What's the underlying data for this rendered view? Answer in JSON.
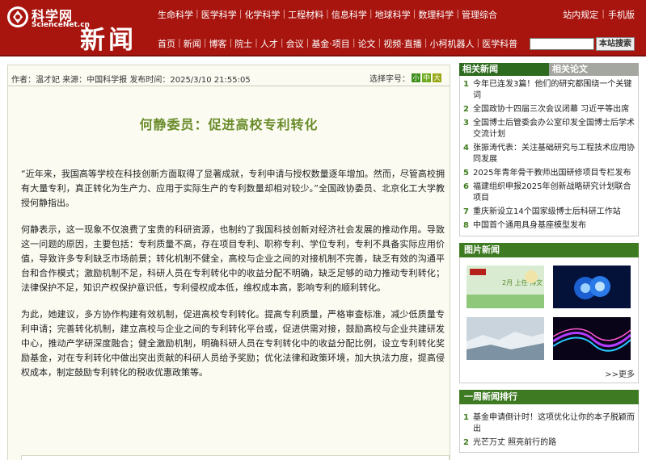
{
  "header": {
    "logo_cn": "科学网",
    "logo_en": "ScienceNet.cn",
    "channel_title": "新闻",
    "subject_nav": [
      "生命科学",
      "医学科学",
      "化学科学",
      "工程材料",
      "信息科学",
      "地球科学",
      "数理科学",
      "管理综合"
    ],
    "main_nav": [
      "首页",
      "新闻",
      "博客",
      "院士",
      "人才",
      "会议",
      "基金·项目",
      "论文",
      "视频·直播",
      "小柯机器人",
      "医学科普"
    ],
    "top_links": [
      "站内规定",
      "手机版"
    ],
    "search_placeholder": "",
    "search_button": "本站搜索"
  },
  "article": {
    "meta": "作者：温才妃 来源：中国科学报 发布时间：2025/3/10 21:55:05",
    "font_size_label": "选择字号：",
    "font_sizes": [
      "小",
      "中",
      "大"
    ],
    "title": "何静委员：促进高校专利转化",
    "paragraphs": [
      "“近年来，我国高等学校在科技创新方面取得了显著成就，专利申请与授权数量逐年增加。然而，尽管高校拥有大量专利，真正转化为生产力、应用于实际生产的专利数量却相对较少。”全国政协委员、北京化工大学教授何静指出。",
      "何静表示，这一现象不仅浪费了宝贵的科研资源，也制约了我国科技创新对经济社会发展的推动作用。导致这一问题的原因，主要包括：专利质量不高，存在项目专利、职称专利、学位专利，专利不具备实际应用价值，导致许多专利缺乏市场前景；转化机制不健全，高校与企业之间的对接机制不完善，缺乏有效的沟通平台和合作模式；激励机制不足，科研人员在专利转化中的收益分配不明确，缺乏足够的动力推动专利转化；法律保护不足，知识产权保护意识低，专利侵权成本低，维权成本高，影响专利的顺利转化。",
      "为此，她建议，多方协作构建有效机制，促进高校专利转化。提高专利质量，严格审查标准，减少低质量专利申请；完善转化机制，建立高校与企业之间的专利转化平台或，促进供需对接，鼓励高校与企业共建研发中心，推动产学研深度融合；健全激励机制，明确科研人员在专利转化中的收益分配比例，设立专利转化奖励基金，对在专利转化中做出突出贡献的科研人员给予奖励；优化法律和政策环境，加大执法力度，提高侵权成本，制定鼓励专利转化的税收优惠政策等。"
    ]
  },
  "sidebar": {
    "tabs": [
      "相关新闻",
      "相关论文"
    ],
    "related_news": [
      {
        "num": "1",
        "text": "今年已连发3篇！他们的研究都围绕一个关键词"
      },
      {
        "num": "2",
        "text": "全国政协十四届三次会议闭幕 习近平等出席"
      },
      {
        "num": "3",
        "text": "全国博士后管委会办公室印发全国博士后学术交流计划"
      },
      {
        "num": "4",
        "text": "张振涛代表：关注基础研究与工程技术应用协同发展"
      },
      {
        "num": "5",
        "text": "2025年青年骨干教师出国研修项目专栏发布"
      },
      {
        "num": "6",
        "text": "福建组织申报2025年创新战略研究计划联合项目"
      },
      {
        "num": "7",
        "text": "重庆新设立14个国家级博士后科研工作站"
      },
      {
        "num": "8",
        "text": "中国首个通用具身基座模型发布"
      }
    ],
    "photo_title": "图片新闻",
    "photo_overlay_text": "2月 上任·博文",
    "more": ">>更多",
    "weekly_title": "一周新闻排行",
    "weekly_news": [
      {
        "num": "1",
        "text": "基金申请倒计时！这项优化让你的本子脱颖而出"
      },
      {
        "num": "2",
        "text": "光芒万丈 照亮前行的路"
      }
    ]
  },
  "colors": {
    "header_red": "#a8150f",
    "title_green": "#6a8c2a",
    "section_green": "#3e7a22"
  }
}
